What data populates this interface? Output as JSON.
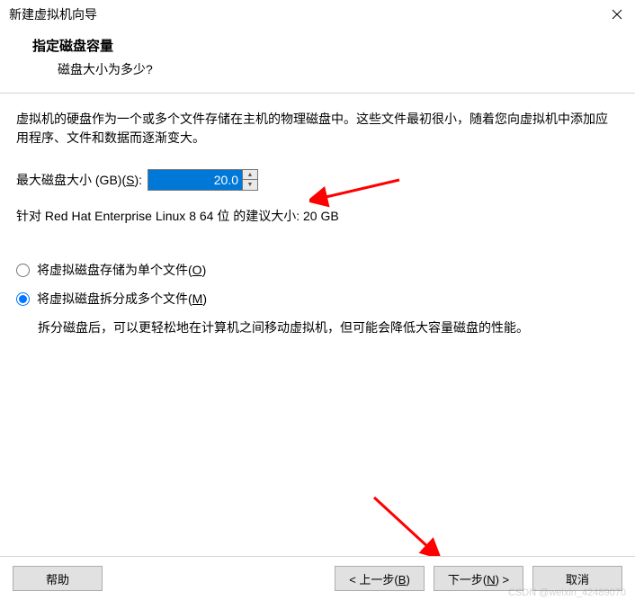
{
  "titlebar": {
    "title": "新建虚拟机向导"
  },
  "header": {
    "title": "指定磁盘容量",
    "subtitle": "磁盘大小为多少?"
  },
  "content": {
    "intro": "虚拟机的硬盘作为一个或多个文件存储在主机的物理磁盘中。这些文件最初很小，随着您向虚拟机中添加应用程序、文件和数据而逐渐变大。",
    "size_label_prefix": "最大磁盘大小 (GB)(",
    "size_hotkey": "S",
    "size_label_suffix": "):",
    "size_value": "20.0",
    "recommend": "针对 Red Hat Enterprise Linux 8 64 位 的建议大小: 20 GB"
  },
  "radio": {
    "single_prefix": "将虚拟磁盘存储为单个文件(",
    "single_hotkey": "O",
    "single_suffix": ")",
    "split_prefix": "将虚拟磁盘拆分成多个文件(",
    "split_hotkey": "M",
    "split_suffix": ")",
    "split_description": "拆分磁盘后，可以更轻松地在计算机之间移动虚拟机，但可能会降低大容量磁盘的性能。"
  },
  "footer": {
    "help": "帮助",
    "back_prefix": "< 上一步(",
    "back_hotkey": "B",
    "back_suffix": ")",
    "next_prefix": "下一步(",
    "next_hotkey": "N",
    "next_suffix": ") >",
    "cancel": "取消"
  },
  "watermark": "CSDN @weixin_42489070"
}
